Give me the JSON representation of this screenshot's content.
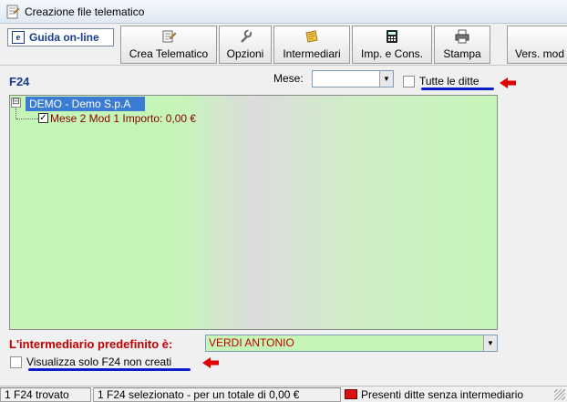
{
  "window": {
    "title": "Creazione file telematico",
    "icon": "app-document-icon"
  },
  "toolbar": {
    "help_label": "Guida on-line",
    "buttons": [
      {
        "label": "Crea Telematico",
        "icon": "create-file-icon"
      },
      {
        "label": "Opzioni",
        "icon": "wrench-icon"
      },
      {
        "label": "Intermediari",
        "icon": "notes-icon"
      },
      {
        "label": "Imp. e Cons.",
        "icon": "calculator-icon"
      },
      {
        "label": "Stampa",
        "icon": "printer-icon"
      },
      {
        "label": "Vers. mod",
        "icon": ""
      }
    ]
  },
  "form": {
    "section_label": "F24",
    "mese_label": "Mese:",
    "mese_value": "",
    "tutte_ditte_label": "Tutte le ditte",
    "tutte_ditte_checked": false
  },
  "tree": {
    "root_label": "DEMO - Demo S.p.A",
    "root_expander": "⊟",
    "children": [
      {
        "label": "Mese 2 Mod 1 Importo: 0,00 €",
        "checked": true
      }
    ]
  },
  "intermediario": {
    "label": "L'intermediario predefinito è:",
    "value": "VERDI ANTONIO"
  },
  "filter": {
    "label": "Visualizza solo F24 non creati",
    "checked": false
  },
  "status": {
    "panel1": "1 F24 trovato",
    "panel2": "1 F24 selezionato - per un totale di 0,00 €",
    "panel3": "Presenti ditte senza intermediario"
  },
  "colors": {
    "tree_background": "#c6f5b8",
    "selection": "#3b7bd4",
    "annotation_underline": "#0a1ec8",
    "annotation_arrow": "#e00000",
    "status_flag": "#d81010"
  }
}
